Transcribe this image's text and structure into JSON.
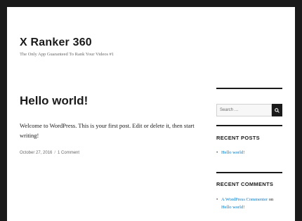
{
  "site": {
    "title": "X Ranker 360",
    "description": "The Only App Guaranteed To Rank Your Videos #1"
  },
  "post": {
    "title": "Hello world!",
    "content": "Welcome to WordPress. This is your first post. Edit or delete it, then start writing!",
    "date": "October 27, 2016",
    "separator": "/",
    "comments": "1 Comment"
  },
  "search": {
    "placeholder": "Search …",
    "icon": "search-icon"
  },
  "recent_posts": {
    "title": "RECENT POSTS",
    "items": [
      {
        "label": "Hello world!"
      }
    ]
  },
  "recent_comments": {
    "title": "RECENT COMMENTS",
    "items": [
      {
        "author": "A WordPress Commenter",
        "on": "on",
        "post": "Hello world!"
      }
    ]
  },
  "colors": {
    "accent_link": "#007acc",
    "text": "#1a1a1a",
    "frame": "#1a1a1a"
  }
}
